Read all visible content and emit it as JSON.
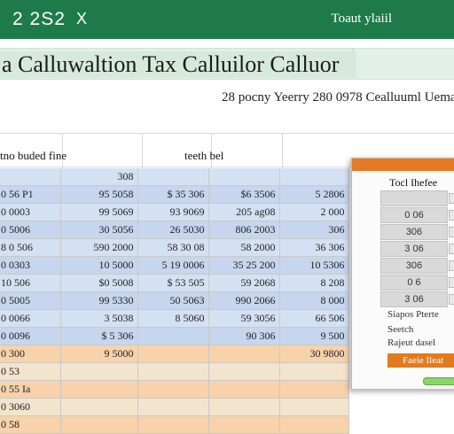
{
  "titlebar": {
    "left": "2 2S2",
    "close": "X",
    "right": "Toaut ylaiil"
  },
  "heading": "a Calluwaltion Tax Calluilor Calluor",
  "subline": "28 pocny Yeerry 280 0978 Cealluuml Uema",
  "columns": {
    "a": "tno buded fine",
    "b": "teeth bel"
  },
  "rows": [
    [
      "",
      "308",
      "",
      "",
      ""
    ],
    [
      "0 56 P1",
      "95 5058",
      "$ 35 306",
      "$6 3506",
      "5 2806"
    ],
    [
      "0 0003",
      "99 5069",
      "93 9069",
      "205 ag08",
      "2 000"
    ],
    [
      "0 5006",
      "30 5056",
      "26 5030",
      "806 2003",
      "306"
    ],
    [
      "8 0 506",
      "590 2000",
      "58 30 08",
      "58 2000",
      "36 306"
    ],
    [
      "0 0303",
      "10 5000",
      "5 19 0006",
      "35 25 200",
      "10 5306"
    ],
    [
      "10 506",
      "$0 5008",
      "$ 53 505",
      "59 2068",
      "8 208"
    ],
    [
      "0 5005",
      "99 5330",
      "50 5063",
      "990 2066",
      "8 000"
    ],
    [
      "0 0066",
      "3 5038",
      "8 5060",
      "59 3056",
      "66 506"
    ],
    [
      "0 0096",
      "$ 5 306",
      "",
      "90 306",
      "9 500"
    ],
    [
      "0 300",
      "9 5000",
      "",
      "",
      "30 9800"
    ],
    [
      "0 53",
      "",
      "",
      "",
      ""
    ],
    [
      "0 55 Ia",
      "",
      "",
      "",
      ""
    ],
    [
      "0 3060",
      "",
      "",
      "",
      ""
    ],
    [
      "0 58",
      "",
      "",
      "",
      ""
    ]
  ],
  "panel": {
    "title": "Tocl Ihefee",
    "rows": [
      "",
      "0 06",
      "306",
      "3 06",
      "306",
      "0 6",
      "3 06"
    ],
    "notes": [
      "Siapos Pterte",
      "Seetch",
      "Rajeut dasel"
    ],
    "button": "Faeie Ileat"
  }
}
